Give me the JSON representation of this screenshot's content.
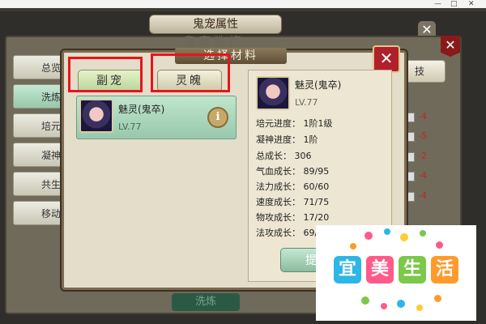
{
  "window": {
    "min_glyph": "—",
    "max_glyph": "□",
    "close_glyph": "✕"
  },
  "background": {
    "title": "鬼宠属性",
    "subtitle": "鬼宠洗炼",
    "menu": [
      "总览",
      "洗炼",
      "培元",
      "凝神",
      "共生",
      "移动"
    ],
    "right_button": "技",
    "deltas": [
      "-4",
      "-5",
      "-2",
      "-4",
      "-4"
    ],
    "bottom_button": "洗炼",
    "close_glyph": "✕"
  },
  "dialog": {
    "title": "选择材料",
    "close_glyph": "✕",
    "tabs": [
      "副宠",
      "灵魄"
    ],
    "selected_tab": "副宠",
    "card": {
      "name": "魅灵(鬼卒)",
      "level": "LV.77",
      "info_glyph": "i"
    },
    "detail": {
      "name": "魅灵(鬼卒)",
      "level": "LV.77",
      "stats": [
        "培元进度： 1阶1级",
        "凝神进度： 1阶",
        "总成长： 306",
        "气血成长： 89/95",
        "法力成长： 60/60",
        "速度成长： 71/75",
        "物攻成长： 17/20",
        "法攻成长： 69/"
      ]
    },
    "confirm_button": "提"
  },
  "watermark": {
    "chars": [
      "宜",
      "美",
      "生",
      "活"
    ],
    "colors": [
      "#2db6e6",
      "#ff5a8a",
      "#7cc84a",
      "#ff9a2b"
    ]
  }
}
